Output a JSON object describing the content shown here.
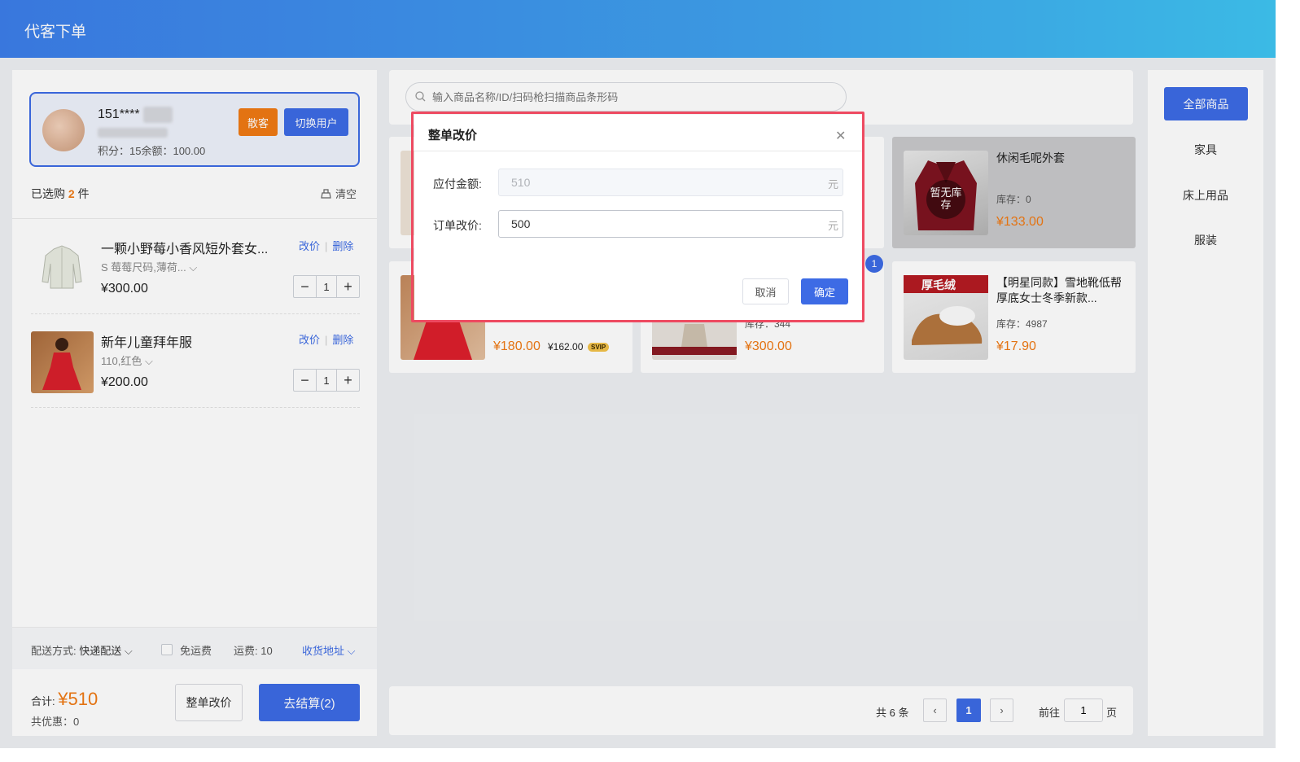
{
  "header": {
    "title": "代客下单"
  },
  "user": {
    "phone": "151****",
    "points_text": "积分：15余额：100.00",
    "guest_label": "散客",
    "switch_label": "切换用户"
  },
  "cart": {
    "selected_prefix": "已选购",
    "selected_count": "2",
    "selected_suffix": "件",
    "clear_label": "清空",
    "items": [
      {
        "name": "一颗小野莓小香风短外套女...",
        "spec": "S 莓莓尺码,薄荷...",
        "price": "¥300.00",
        "qty": "1",
        "edit_label": "改价",
        "delete_label": "删除"
      },
      {
        "name": "新年儿童拜年服",
        "spec": "110,红色",
        "price": "¥200.00",
        "qty": "1",
        "edit_label": "改价",
        "delete_label": "删除"
      }
    ]
  },
  "delivery": {
    "method_label": "配送方式:",
    "method_value": "快递配送",
    "free_shipping_label": "免运费",
    "fee_text": "运费: 10",
    "address_label": "收货地址"
  },
  "totals": {
    "total_label": "合计:",
    "total_amount": "¥510",
    "discount_text": "共优惠：0",
    "adjust_label": "整单改价",
    "checkout_label": "去结算(2)"
  },
  "search": {
    "placeholder": "输入商品名称/ID/扫码枪扫描商品条形码"
  },
  "products": [
    {
      "name": "休闲毛呢外套",
      "stock": "库存：0",
      "price": "¥133.00",
      "no_stock": "暂无库存"
    },
    {
      "name": "",
      "stock": "",
      "price": "¥180.00",
      "svip_price": "¥162.00",
      "svip_badge": "SVIP"
    },
    {
      "name": "",
      "stock": "库存：344",
      "price": "¥300.00"
    },
    {
      "name": "【明星同款】雪地靴低帮厚底女士冬季新款...",
      "stock": "库存：4987",
      "price": "¥17.90",
      "thumb_text": "厚毛绒"
    }
  ],
  "cart_badge": "1",
  "pagination": {
    "total_text": "共 6 条",
    "current": "1",
    "goto_label": "前往",
    "goto_value": "1",
    "page_suffix": "页"
  },
  "categories": {
    "active": "全部商品",
    "items": [
      "家具",
      "床上用品",
      "服装"
    ]
  },
  "modal": {
    "title": "整单改价",
    "payable_label": "应付金额:",
    "payable_value": "510",
    "adjust_label": "订单改价:",
    "adjust_value": "500",
    "unit": "元",
    "cancel_label": "取消",
    "ok_label": "确定"
  },
  "colors": {
    "primary": "#3d6be5",
    "accent": "#f07a14",
    "highlight": "#ee4a61"
  }
}
